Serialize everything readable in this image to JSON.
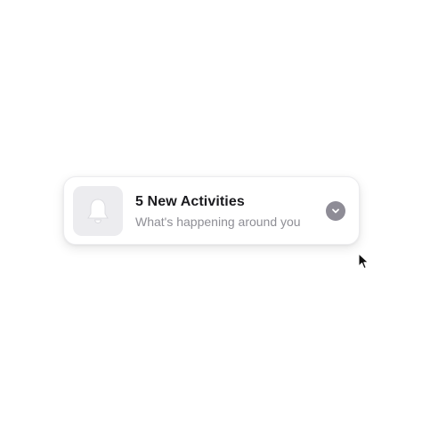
{
  "notification": {
    "title": "5 New Activities",
    "subtitle": "What's happening around you",
    "icon": "bell-icon",
    "expand_icon": "chevron-down-icon"
  },
  "colors": {
    "background": "#ffffff",
    "card": "#ffffff",
    "icon_tile": "#ececef",
    "title": "#1b1b1f",
    "subtitle": "#8e8e95",
    "expand_button": "#8e8c96"
  }
}
